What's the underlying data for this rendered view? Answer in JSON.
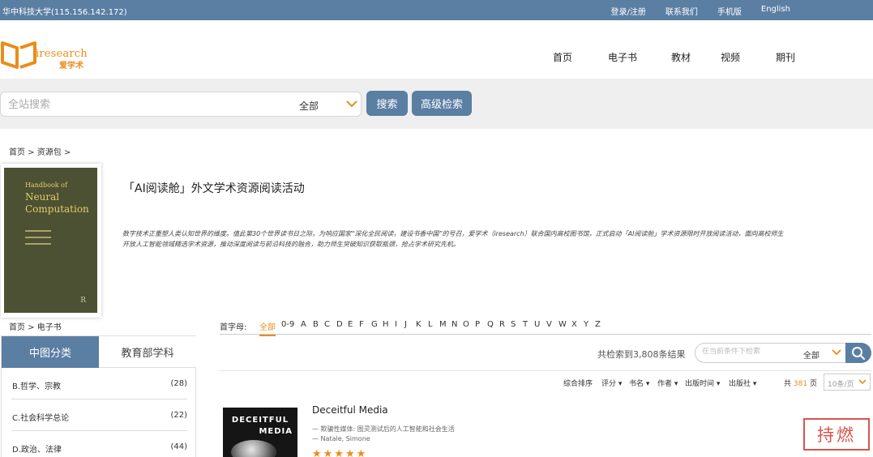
{
  "topbar": {
    "org": "华中科技大学(115.156.142.172)",
    "links": [
      "登录/注册",
      "联系我们",
      "手机版",
      "English"
    ]
  },
  "logo": {
    "brand": "iresearch",
    "brand_cn": "爱学术"
  },
  "nav": [
    "首页",
    "电子书",
    "教材",
    "视频",
    "期刊"
  ],
  "search": {
    "placeholder": "全站搜索",
    "scope": "全部",
    "search_label": "搜索",
    "advanced_label": "高级检索"
  },
  "breadcrumb1": "首页 > 资源包 >",
  "package": {
    "cover_small": "Handbook of",
    "cover_big": "Neural Computation",
    "cover_mark": "R",
    "title": "「AI阅读舱」外文学术资源阅读活动",
    "description": "数字技术正重塑人类认知世界的维度。值此第30个世界读书日之际，为响应国家“深化全民阅读，建设书香中国”的号召，爱学术（iresearch）联合国内高校图书馆，正式启动「AI阅读舱」学术资源限时开放阅读活动，面向高校师生开放人工智能领域精选学术资源，推动深度阅读与前沿科技的融合，助力师生突破知识获取瓶颈，抢占学术研究先机。"
  },
  "breadcrumb2": "首页 > 电子书",
  "tabs": {
    "active": "中图分类",
    "inactive": "教育部学科"
  },
  "categories": [
    {
      "name": "B.哲学、宗教",
      "count": "(28)"
    },
    {
      "name": "C.社会科学总论",
      "count": "(22)"
    },
    {
      "name": "D.政治、法律",
      "count": "(44)"
    }
  ],
  "letters": {
    "label": "首字母:",
    "items": [
      "全部",
      "0-9",
      "A",
      "B",
      "C",
      "D",
      "E",
      "F",
      "G",
      "H",
      "I",
      "J",
      "K",
      "L",
      "M",
      "N",
      "O",
      "P",
      "Q",
      "R",
      "S",
      "T",
      "U",
      "V",
      "W",
      "X",
      "Y",
      "Z"
    ]
  },
  "results": {
    "count_text": "共检索到3,808条结果",
    "filter_placeholder": "在当前条件下检索",
    "filter_scope": "全部"
  },
  "sort": {
    "options": [
      "综合排序",
      "评分",
      "书名",
      "作者",
      "出版时间",
      "出版社"
    ],
    "pages_prefix": "共",
    "pages": "381",
    "pages_suffix": "页",
    "per_page": "10条/页"
  },
  "book": {
    "cover_line1": "DECEITFUL",
    "cover_line2": "MEDIA",
    "title": "Deceitful Media",
    "subtitle": "— 欺骗性媒体: 图灵测试后的人工智能和社会生活",
    "author": "— Natale, Simone",
    "rating": 5
  },
  "stamp_text": "持燃",
  "colors": {
    "primary": "#5b7ea3",
    "accent": "#e98d1b",
    "stamp": "#d9534f"
  }
}
